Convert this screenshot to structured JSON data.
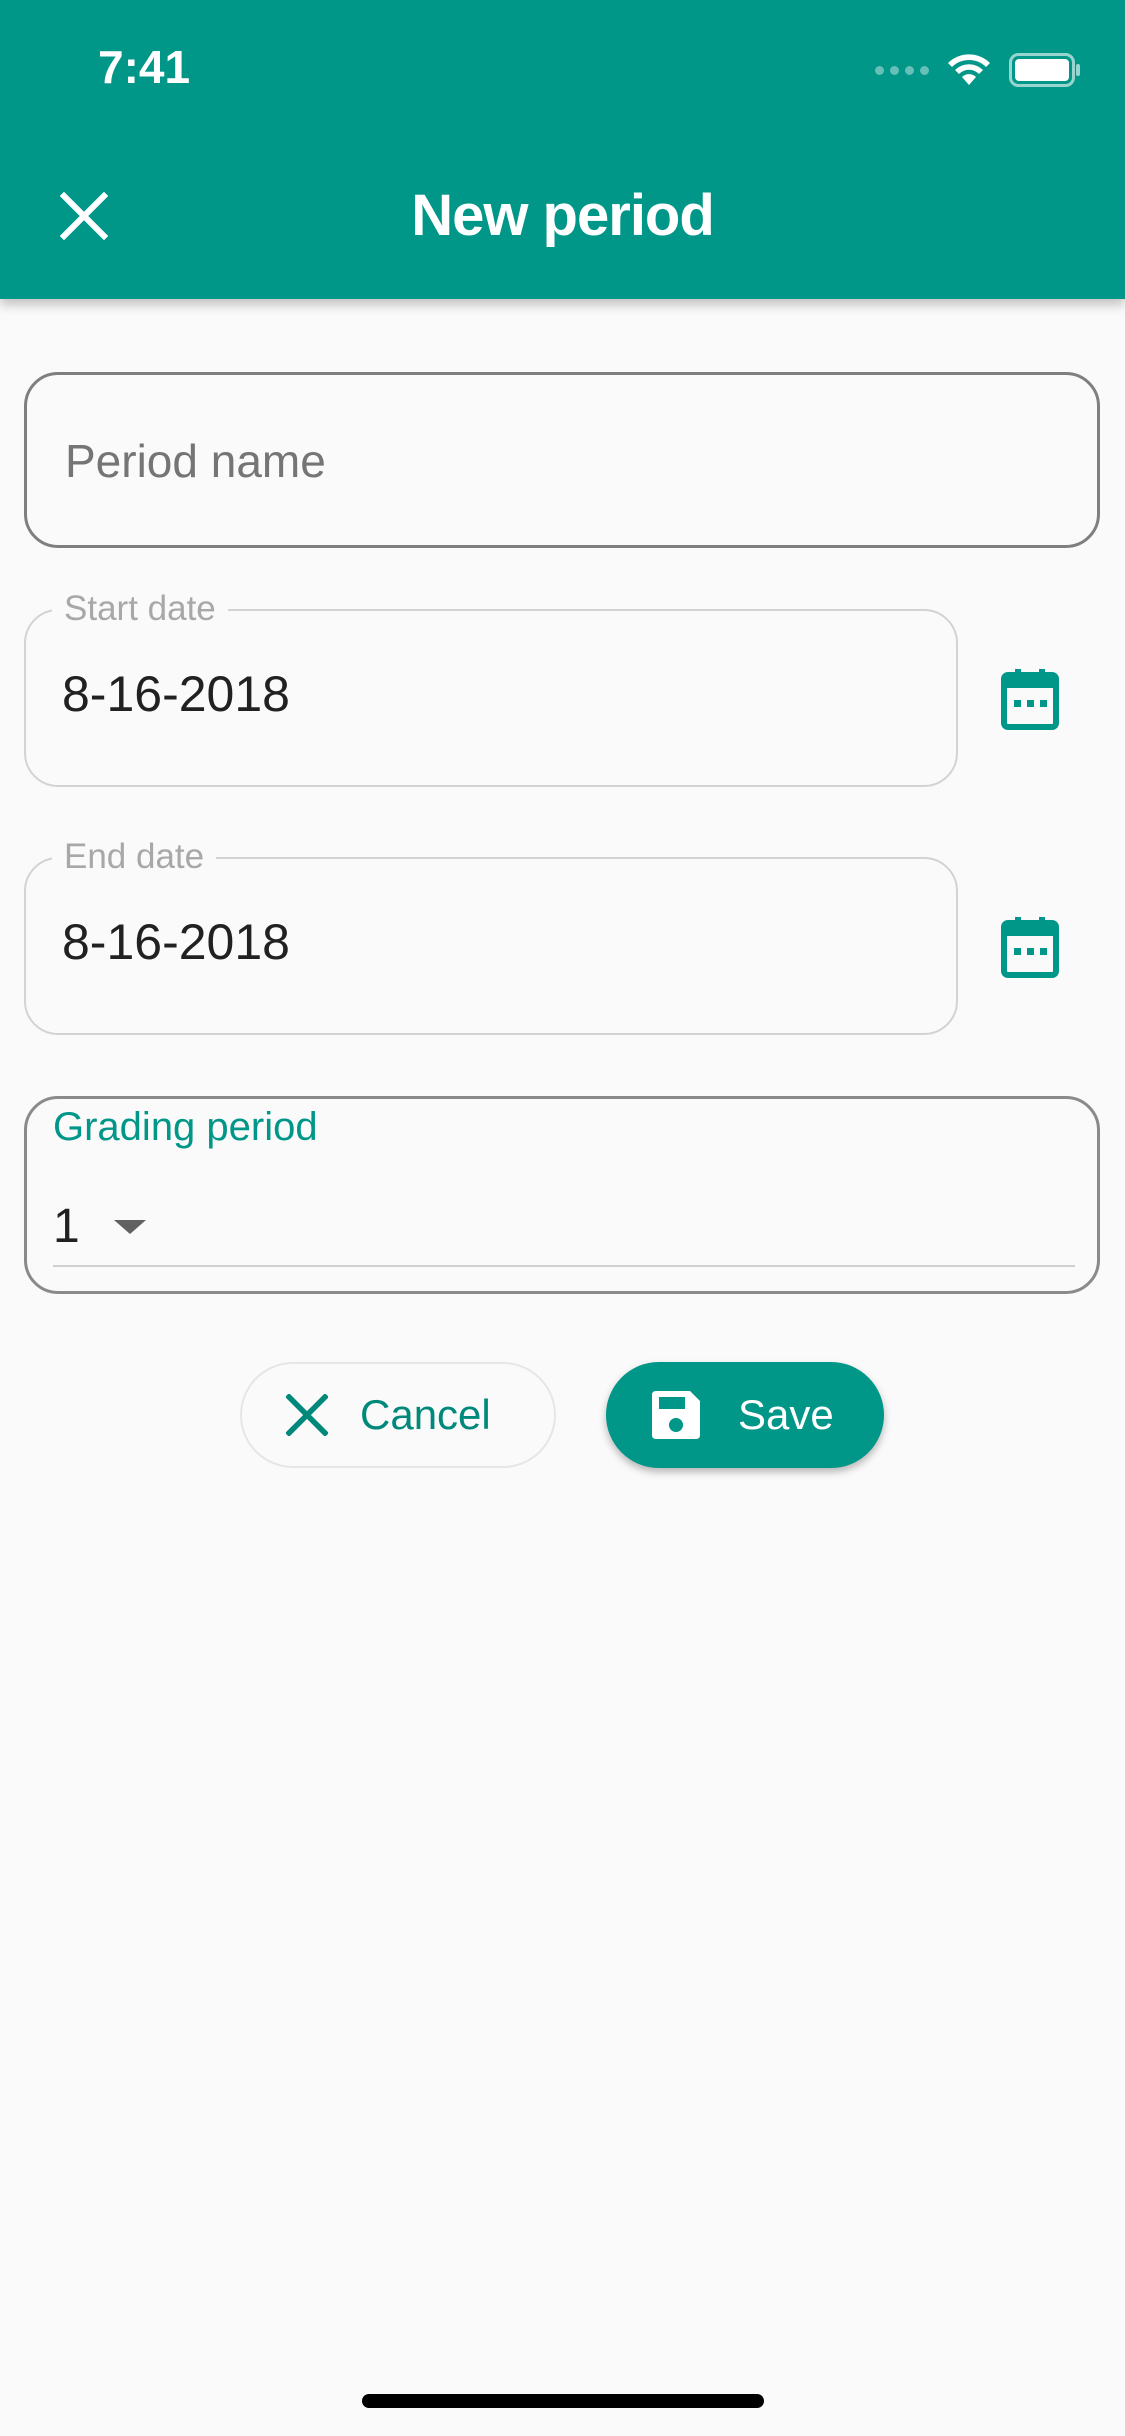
{
  "status_bar": {
    "time": "7:41"
  },
  "header": {
    "title": "New period",
    "close_icon": "close-icon"
  },
  "form": {
    "period_name": {
      "placeholder": "Period name",
      "value": ""
    },
    "start_date": {
      "label": "Start date",
      "value": "8-16-2018",
      "icon": "calendar-icon"
    },
    "end_date": {
      "label": "End date",
      "value": "8-16-2018",
      "icon": "calendar-icon"
    },
    "grading_period": {
      "label": "Grading period",
      "selected": "1"
    }
  },
  "actions": {
    "cancel_label": "Cancel",
    "save_label": "Save"
  },
  "colors": {
    "primary": "#009688",
    "primary_text": "#00897b",
    "background": "#fafafa"
  }
}
